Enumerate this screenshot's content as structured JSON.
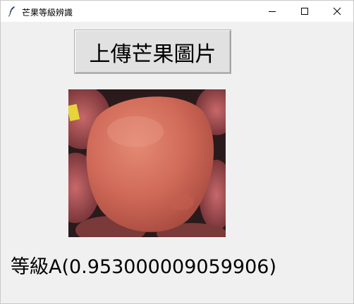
{
  "window": {
    "title": "芒果等級辨識",
    "icon": "feather-icon"
  },
  "controls": {
    "minimize_icon": "minimize-icon",
    "maximize_icon": "maximize-icon",
    "close_icon": "close-icon"
  },
  "upload": {
    "label": "上傳芒果圖片"
  },
  "photo": {
    "label_sticker": "",
    "subject": "mango"
  },
  "result": {
    "text": "等級A(0.953000009059906)"
  },
  "colors": {
    "background": "#f0f0f0",
    "titlebar": "#ffffff",
    "button_face": "#e1e1e1"
  }
}
